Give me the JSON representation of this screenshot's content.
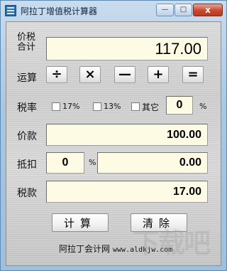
{
  "window": {
    "title": "阿拉丁增值税计算器",
    "minimize": "—",
    "maximize": "□",
    "close": "x"
  },
  "rows": {
    "tax_inclusive_label_line1": "价税",
    "tax_inclusive_label_line2": "合计",
    "tax_inclusive_value": "117.00",
    "operation_label": "运算",
    "operators": [
      "÷",
      "×",
      "—",
      "+",
      "="
    ],
    "rate_label": "税率",
    "rate_options": [
      "17%",
      "13%",
      "其它"
    ],
    "rate_custom_value": "0",
    "rate_unit": "%",
    "price_label": "价款",
    "price_value": "100.00",
    "deduct_label": "抵扣",
    "deduct_rate_value": "0",
    "deduct_unit": "%",
    "deduct_amount_value": "0.00",
    "tax_label": "税款",
    "tax_value": "17.00"
  },
  "actions": {
    "calculate": "计算",
    "clear": "清除"
  },
  "footer": {
    "name": "阿拉丁会计网",
    "url": "www.aldkjw.com"
  },
  "watermark": "下载吧"
}
